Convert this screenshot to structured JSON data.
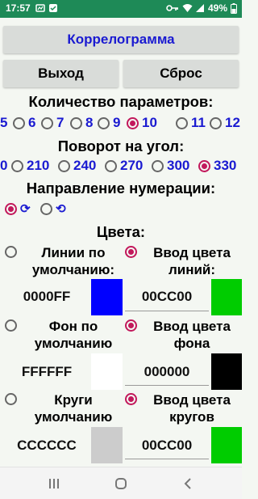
{
  "status": {
    "time": "17:57",
    "battery": "49%"
  },
  "title_button": "Коррелограмма",
  "exit_button": "Выход",
  "reset_button": "Сброс",
  "params": {
    "heading": "Количество параметров:",
    "options": [
      "5",
      "6",
      "7",
      "8",
      "9",
      "10",
      "11",
      "12"
    ],
    "selected": "10"
  },
  "rotation": {
    "heading": "Поворот на угол:",
    "options": [
      "0",
      "210",
      "240",
      "270",
      "300",
      "330"
    ],
    "selected": "330"
  },
  "direction": {
    "heading": "Направление нумерации:",
    "options": [
      {
        "icon": "clockwise-arrow-icon",
        "glyph": "⟳"
      },
      {
        "icon": "counterclockwise-arrow-icon",
        "glyph": "⟲"
      }
    ],
    "selected_index": 0
  },
  "colors": {
    "heading": "Цвета:",
    "lines": {
      "default_label": "Линии по умолчанию:",
      "input_label": "Ввод цвета линий:",
      "default_value": "0000FF",
      "input_value": "00CC00",
      "default_color": "#0000ff",
      "input_color": "#00cc00",
      "selected": "input"
    },
    "background": {
      "default_label": "Фон по умолчанию",
      "input_label": "Ввод цвета фона",
      "default_value": "FFFFFF",
      "input_value": "000000",
      "default_color": "#ffffff",
      "input_color": "#000000",
      "selected": "input"
    },
    "circles": {
      "default_label": "Круги умолчанию",
      "input_label": "Ввод цвета кругов",
      "default_value": "CCCCCC",
      "input_value": "00CC00",
      "default_color": "#cccccc",
      "input_color": "#00cc00",
      "selected": "input"
    }
  },
  "accent_color": "#c2185b",
  "status_bar_color": "#1e8a57"
}
